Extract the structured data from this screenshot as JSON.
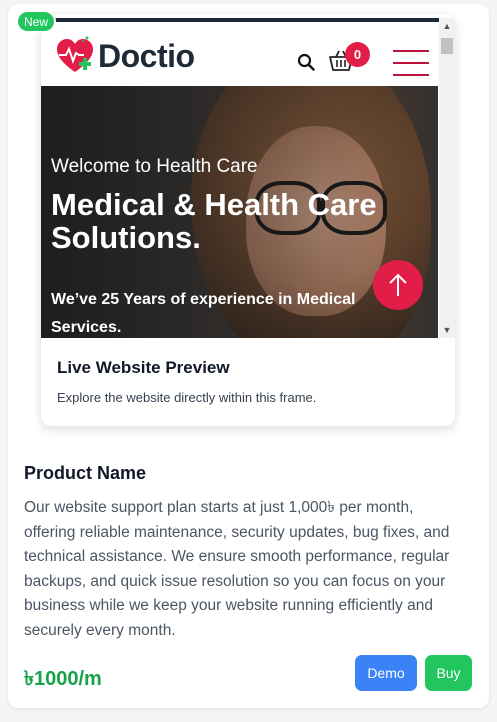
{
  "badge": {
    "label": "New"
  },
  "preview": {
    "site": {
      "logo_text": "Doctio",
      "cart_count": "0",
      "hero": {
        "subtitle": "Welcome to Health Care",
        "title": "Medical & Health Care Solutions.",
        "text": "We’ve 25 Years of experience in Medical Services."
      }
    },
    "title": "Live Website Preview",
    "description": "Explore the website directly within this frame."
  },
  "product": {
    "name": "Product Name",
    "description": "Our website support plan starts at just 1,000৳ per month, offering reliable maintenance, security updates, bug fixes, and technical assistance. We ensure smooth performance, regular backups, and quick issue resolution so you can focus on your business while we keep your website running efficiently and securely every month.",
    "price": "৳1000/m"
  },
  "actions": {
    "demo_label": "Demo",
    "buy_label": "Buy"
  },
  "colors": {
    "accent_green": "#22c55e",
    "accent_blue": "#3b82f6",
    "brand_red": "#e11d48",
    "price_green": "#16a34a"
  },
  "icons": [
    "heart-logo-icon",
    "search-icon",
    "cart-icon",
    "menu-icon",
    "arrow-up-icon"
  ]
}
